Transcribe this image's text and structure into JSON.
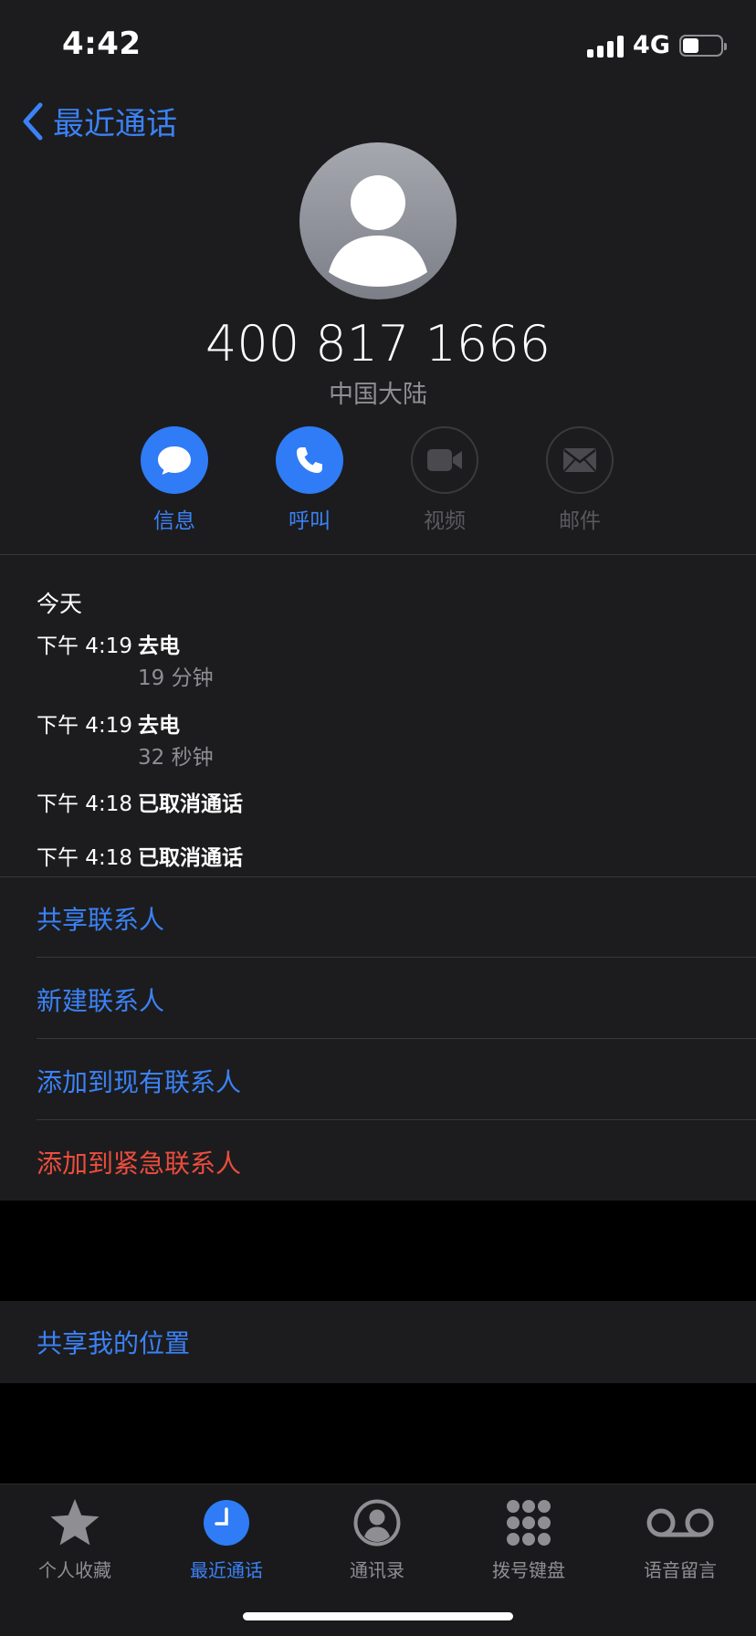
{
  "status": {
    "time": "4:42",
    "network": "4G",
    "battery_level": 0.42
  },
  "nav": {
    "back_label": "最近通话"
  },
  "contact": {
    "number": "400 817 1666",
    "region": "中国大陆"
  },
  "actions": [
    {
      "label": "信息",
      "icon": "message-icon",
      "enabled": true
    },
    {
      "label": "呼叫",
      "icon": "phone-icon",
      "enabled": true
    },
    {
      "label": "视频",
      "icon": "video-icon",
      "enabled": false
    },
    {
      "label": "邮件",
      "icon": "mail-icon",
      "enabled": false
    }
  ],
  "history": {
    "day": "今天",
    "calls": [
      {
        "time": "下午 4:19",
        "type": "去电",
        "duration": "19 分钟"
      },
      {
        "time": "下午 4:19",
        "type": "去电",
        "duration": "32 秒钟"
      },
      {
        "time": "下午 4:18",
        "type": "已取消通话",
        "duration": ""
      },
      {
        "time": "下午 4:18",
        "type": "已取消通话",
        "duration": ""
      }
    ]
  },
  "options": {
    "share_contact": "共享联系人",
    "new_contact": "新建联系人",
    "add_existing": "添加到现有联系人",
    "add_emergency": "添加到紧急联系人",
    "share_location": "共享我的位置"
  },
  "tabs": [
    {
      "label": "个人收藏",
      "icon": "star-icon",
      "active": false
    },
    {
      "label": "最近通话",
      "icon": "clock-icon",
      "active": true
    },
    {
      "label": "通讯录",
      "icon": "contacts-icon",
      "active": false
    },
    {
      "label": "拨号键盘",
      "icon": "keypad-icon",
      "active": false
    },
    {
      "label": "语音留言",
      "icon": "voicemail-icon",
      "active": false
    }
  ],
  "colors": {
    "accent": "#3b82f6",
    "destructive": "#eb4d3d",
    "background": "#1c1c1e"
  }
}
